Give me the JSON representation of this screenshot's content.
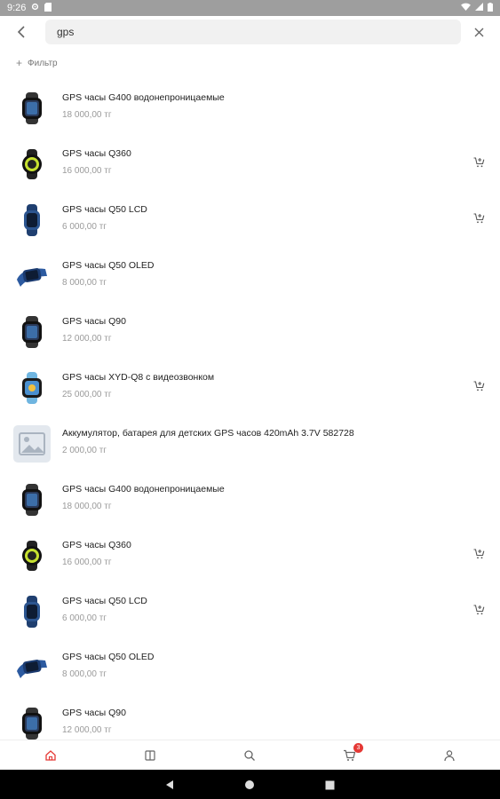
{
  "status_bar": {
    "time": "9:26"
  },
  "search": {
    "query": "gps",
    "placeholder": ""
  },
  "filter": {
    "label": "Фильтр"
  },
  "products": [
    {
      "name": "GPS часы G400 водонепроницаемые",
      "price": "18 000,00 тг",
      "thumb": "watch-black",
      "cart": false
    },
    {
      "name": "GPS часы Q360",
      "price": "16 000,00 тг",
      "thumb": "watch-round-green",
      "cart": true
    },
    {
      "name": "GPS часы Q50 LCD",
      "price": "6 000,00 тг",
      "thumb": "watch-blue-side",
      "cart": true
    },
    {
      "name": "GPS часы Q50 OLED",
      "price": "8 000,00 тг",
      "thumb": "watch-blue-angle",
      "cart": false
    },
    {
      "name": "GPS часы Q90",
      "price": "12 000,00 тг",
      "thumb": "watch-black",
      "cart": false
    },
    {
      "name": "GPS часы XYD-Q8 с видеозвонком",
      "price": "25 000,00 тг",
      "thumb": "watch-lightblue",
      "cart": true
    },
    {
      "name": "Аккумулятор, батарея для детских GPS часов  420mAh 3.7V 582728",
      "price": "2 000,00 тг",
      "thumb": "placeholder",
      "cart": false
    },
    {
      "name": "GPS часы G400 водонепроницаемые",
      "price": "18 000,00 тг",
      "thumb": "watch-black",
      "cart": false
    },
    {
      "name": "GPS часы Q360",
      "price": "16 000,00 тг",
      "thumb": "watch-round-green",
      "cart": true
    },
    {
      "name": "GPS часы Q50 LCD",
      "price": "6 000,00 тг",
      "thumb": "watch-blue-side",
      "cart": true
    },
    {
      "name": "GPS часы Q50 OLED",
      "price": "8 000,00 тг",
      "thumb": "watch-blue-angle",
      "cart": false
    },
    {
      "name": "GPS часы Q90",
      "price": "12 000,00 тг",
      "thumb": "watch-black",
      "cart": false
    }
  ],
  "bottom_nav": {
    "items": [
      "home-icon",
      "catalog-icon",
      "search-icon",
      "cart-icon",
      "profile-icon"
    ],
    "active": "home-icon",
    "cart_count": "3"
  },
  "colors": {
    "accent": "#e53935",
    "status_bar": "#9e9e9e",
    "search_bg": "#f1f1f1"
  }
}
